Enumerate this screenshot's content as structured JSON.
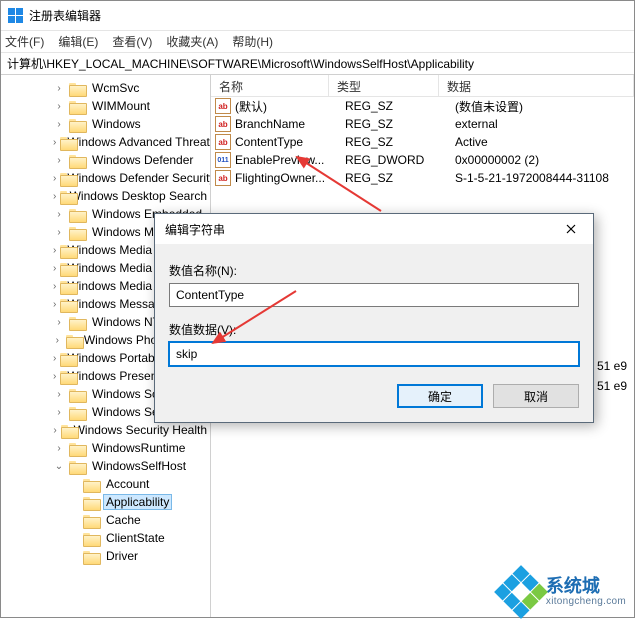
{
  "window": {
    "title": "注册表编辑器"
  },
  "menu": {
    "file": "文件(F)",
    "edit": "编辑(E)",
    "view": "查看(V)",
    "favorites": "收藏夹(A)",
    "help": "帮助(H)"
  },
  "address": "计算机\\HKEY_LOCAL_MACHINE\\SOFTWARE\\Microsoft\\WindowsSelfHost\\Applicability",
  "columns": {
    "name": "名称",
    "type": "类型",
    "data": "数据"
  },
  "tree": {
    "items": [
      {
        "label": "WcmSvc",
        "depth": 1,
        "exp": ">"
      },
      {
        "label": "WIMMount",
        "depth": 1,
        "exp": ">"
      },
      {
        "label": "Windows",
        "depth": 1,
        "exp": ">"
      },
      {
        "label": "Windows Advanced Threat Protection",
        "depth": 1,
        "exp": ">"
      },
      {
        "label": "Windows Defender",
        "depth": 1,
        "exp": ">"
      },
      {
        "label": "Windows Defender Security Center",
        "depth": 1,
        "exp": ">"
      },
      {
        "label": "Windows Desktop Search",
        "depth": 1,
        "exp": ">"
      },
      {
        "label": "Windows Embedded",
        "depth": 1,
        "exp": ">"
      },
      {
        "label": "Windows Mail",
        "depth": 1,
        "exp": ">"
      },
      {
        "label": "Windows Media Device Manager",
        "depth": 1,
        "exp": ">"
      },
      {
        "label": "Windows Media Foundation",
        "depth": 1,
        "exp": ">"
      },
      {
        "label": "Windows Media Player NSS",
        "depth": 1,
        "exp": ">"
      },
      {
        "label": "Windows Messaging Subsystem",
        "depth": 1,
        "exp": ">"
      },
      {
        "label": "Windows NT",
        "depth": 1,
        "exp": ">"
      },
      {
        "label": "Windows Photo Viewer",
        "depth": 1,
        "exp": ">"
      },
      {
        "label": "Windows Portable Devices",
        "depth": 1,
        "exp": ">"
      },
      {
        "label": "Windows Presentation Foundation",
        "depth": 1,
        "exp": ">"
      },
      {
        "label": "Windows Script Host",
        "depth": 1,
        "exp": ">"
      },
      {
        "label": "Windows Search",
        "depth": 1,
        "exp": ">"
      },
      {
        "label": "Windows Security Health",
        "depth": 1,
        "exp": ">"
      },
      {
        "label": "WindowsRuntime",
        "depth": 1,
        "exp": ">"
      },
      {
        "label": "WindowsSelfHost",
        "depth": 1,
        "exp": "v"
      },
      {
        "label": "Account",
        "depth": 2,
        "exp": ""
      },
      {
        "label": "Applicability",
        "depth": 2,
        "exp": "",
        "selected": true
      },
      {
        "label": "Cache",
        "depth": 2,
        "exp": ""
      },
      {
        "label": "ClientState",
        "depth": 2,
        "exp": ""
      },
      {
        "label": "Driver",
        "depth": 2,
        "exp": ""
      }
    ]
  },
  "values": [
    {
      "icon": "str",
      "name": "(默认)",
      "type": "REG_SZ",
      "data": "(数值未设置)"
    },
    {
      "icon": "str",
      "name": "BranchName",
      "type": "REG_SZ",
      "data": "external"
    },
    {
      "icon": "str",
      "name": "ContentType",
      "type": "REG_SZ",
      "data": "Active"
    },
    {
      "icon": "bin",
      "name": "EnablePreview...",
      "type": "REG_DWORD",
      "data": "0x00000002 (2)"
    },
    {
      "icon": "str",
      "name": "FlightingOwner...",
      "type": "REG_SZ",
      "data": "S-1-5-21-1972008444-31108"
    }
  ],
  "dialog": {
    "title": "编辑字符串",
    "nameLabel": "数值名称(N):",
    "nameValue": "ContentType",
    "dataLabel": "数值数据(V):",
    "dataValue": "skip",
    "ok": "确定",
    "cancel": "取消"
  },
  "fragments": {
    "a": "51 e9",
    "b": "51 e9"
  },
  "watermark": {
    "text": "系统城",
    "url": "xitongcheng.com"
  }
}
